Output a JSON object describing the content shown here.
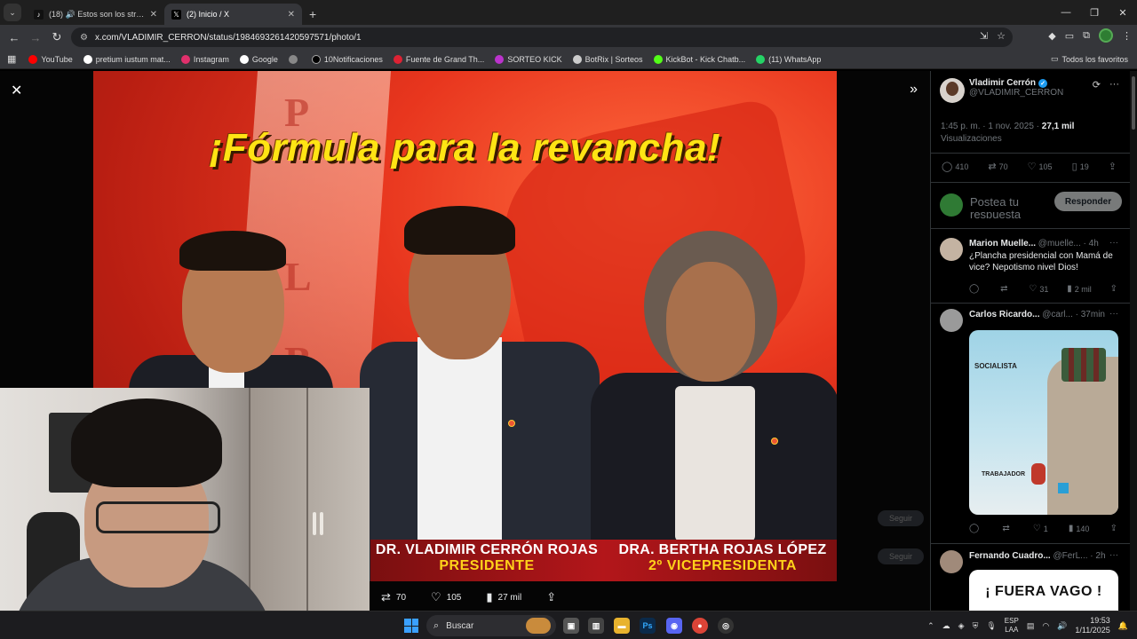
{
  "browser": {
    "tabs": [
      {
        "label": "(18) 🔊 Estos son los streame",
        "active": false
      },
      {
        "label": "(2) Inicio / X",
        "active": true
      }
    ],
    "new_tab": "+",
    "url": "x.com/VLADIMIR_CERRON/status/1984693261420597571/photo/1",
    "bookmarks": [
      {
        "label": "YouTube",
        "color": "#ff0000"
      },
      {
        "label": "pretium iustum mat...",
        "color": "#ffffff"
      },
      {
        "label": "Instagram",
        "color": "#e1306c"
      },
      {
        "label": "Google",
        "color": "#ffffff"
      },
      {
        "label": "",
        "color": "#888888"
      },
      {
        "label": "10Notificaciones",
        "color": "#000000"
      },
      {
        "label": "Fuente de Grand Th...",
        "color": "#d23"
      },
      {
        "label": "SORTEO KICK",
        "color": "#7a2"
      },
      {
        "label": "BotRix | Sorteos",
        "color": "#ccc"
      },
      {
        "label": "KickBot - Kick Chatb...",
        "color": "#53fc18"
      },
      {
        "label": "(11) WhatsApp",
        "color": "#25d366"
      }
    ],
    "all_bookmarks": "Todos los favoritos"
  },
  "photo": {
    "headline": "¡Fórmula para la revancha!",
    "flag_letters": [
      "P",
      "L",
      "B"
    ],
    "caption_left_name": "DR. VLADIMIR CERRÓN ROJAS",
    "caption_left_role": "PRESIDENTE",
    "caption_right_name": "DRA. BERTHA ROJAS LÓPEZ",
    "caption_right_role": "2º VICEPRESIDENTA"
  },
  "viewer_actions": {
    "reposts": "70",
    "likes": "105",
    "views": "27 mil"
  },
  "ghost_buttons": [
    "Seguir",
    "Seguir"
  ],
  "sidebar": {
    "author_name": "Vladimir Cerrón",
    "author_handle": "@VLADIMIR_CERRON",
    "timestamp": "1:45 p. m. · 1 nov. 2025 · ",
    "views_count": "27,1 mil",
    "views_label": "Visualizaciones",
    "stats": {
      "replies": "410",
      "reposts": "70",
      "likes": "105",
      "bookmarks": "19"
    },
    "reply_placeholder": "Postea tu respuesta",
    "reply_button": "Responder",
    "posts": [
      {
        "name": "Marion Muelle...",
        "handle": "@muelle... · 4h",
        "text": "¿Plancha presidencial con Mamá de vice? Nepotismo nivel Dios!",
        "likes": "31",
        "views": "2 mil"
      },
      {
        "name": "Carlos Ricardo...",
        "handle": "@carl... · 37min",
        "image_labels": [
          "SOCIALISTA",
          "TRABAJADOR"
        ],
        "likes": "1",
        "views": "140"
      },
      {
        "name": "Fernando Cuadro...",
        "handle": "@FerL... · 2h",
        "image_text": "¡ FUERA VAGO !"
      }
    ]
  },
  "taskbar": {
    "search_placeholder": "Buscar",
    "lang_top": "ESP",
    "lang_bottom": "LAA",
    "time": "19:53",
    "date": "1/11/2025"
  }
}
